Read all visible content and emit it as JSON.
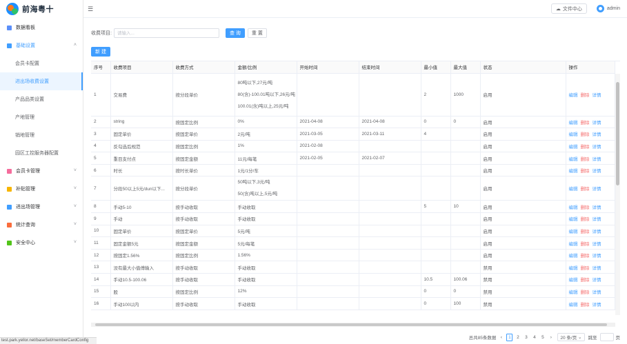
{
  "brand": {
    "name": "前海粤十"
  },
  "sidebar": {
    "items": [
      {
        "label": "数据看板",
        "icon": "dashboard-icon",
        "color": "#5b8ff9"
      },
      {
        "label": "基础设置",
        "icon": "settings-icon",
        "color": "#409eff",
        "expanded": true,
        "children": [
          {
            "label": "会员卡配置"
          },
          {
            "label": "进出场收费设置",
            "selected": true
          },
          {
            "label": "产品品类设置"
          },
          {
            "label": "产地管理"
          },
          {
            "label": "销地管理"
          },
          {
            "label": "园区工控服务器配置"
          }
        ]
      },
      {
        "label": "会员卡管理",
        "icon": "card-icon",
        "color": "#f56c9c"
      },
      {
        "label": "补贴管理",
        "icon": "subsidy-icon",
        "color": "#f7b500"
      },
      {
        "label": "进出场管理",
        "icon": "entry-icon",
        "color": "#409eff"
      },
      {
        "label": "统计查询",
        "icon": "stats-icon",
        "color": "#fa6d3c"
      },
      {
        "label": "安全中心",
        "icon": "shield-icon",
        "color": "#52c41a"
      }
    ]
  },
  "header": {
    "file_center": "文件中心",
    "user": "admin"
  },
  "search": {
    "label": "收费项目:",
    "placeholder": "请输入...",
    "query_btn": "查 询",
    "reset_btn": "重 置",
    "new_btn": "新 建"
  },
  "table": {
    "columns": [
      "序号",
      "收费项目",
      "收费方式",
      "金额/比例",
      "开始时间",
      "结束时间",
      "最小值",
      "最大值",
      "状态",
      "操作"
    ],
    "actions": {
      "edit": "编辑",
      "delete": "删除",
      "detail": "详情"
    },
    "rows": [
      {
        "no": "1",
        "item": "交易费",
        "method": "按分段单价",
        "amount": [
          "80吨以下,27元/吨",
          "80(含)-100.01吨以下,26元/吨",
          "100.01(含)吨以上,25元/吨"
        ],
        "start": "",
        "end": "",
        "min": "2",
        "max": "1000",
        "status": "启用"
      },
      {
        "no": "2",
        "item": "string",
        "method": "按固定比例",
        "amount": [
          "0%"
        ],
        "start": "2021-04-08",
        "end": "2021-04-08",
        "min": "0",
        "max": "0",
        "status": "启用"
      },
      {
        "no": "3",
        "item": "固定单价",
        "method": "按固定单价",
        "amount": [
          "2元/吨"
        ],
        "start": "2021-03-05",
        "end": "2021-03-11",
        "min": "4",
        "max": "",
        "status": "启用"
      },
      {
        "no": "4",
        "item": "反勾选后规范",
        "method": "按固定比例",
        "amount": [
          "1%"
        ],
        "start": "2021-02-08",
        "end": "",
        "min": "",
        "max": "",
        "status": "启用"
      },
      {
        "no": "5",
        "item": "重目支付点",
        "method": "按固定金额",
        "amount": [
          "11元/每笔"
        ],
        "start": "2021-02-05",
        "end": "2021-02-07",
        "min": "",
        "max": "",
        "status": "启用"
      },
      {
        "no": "6",
        "item": "时长",
        "method": "按时长单价",
        "amount": [
          "1元/1分/车"
        ],
        "start": "",
        "end": "",
        "min": "",
        "max": "",
        "status": "启用"
      },
      {
        "no": "7",
        "item": "分段50以上5元/dun以下...",
        "method": "按分段单价",
        "amount": [
          "50吨以下,3元/吨",
          "50(含)吨以上,5元/吨"
        ],
        "start": "",
        "end": "",
        "min": "",
        "max": "",
        "status": "启用"
      },
      {
        "no": "8",
        "item": "手动5-10",
        "method": "按手动收取",
        "amount": [
          "手动收取"
        ],
        "start": "",
        "end": "",
        "min": "5",
        "max": "10",
        "status": "启用"
      },
      {
        "no": "9",
        "item": "手动",
        "method": "按手动收取",
        "amount": [
          "手动收取"
        ],
        "start": "",
        "end": "",
        "min": "",
        "max": "",
        "status": "启用"
      },
      {
        "no": "10",
        "item": "固定单价",
        "method": "按固定单价",
        "amount": [
          "5元/吨"
        ],
        "start": "",
        "end": "",
        "min": "",
        "max": "",
        "status": "启用"
      },
      {
        "no": "11",
        "item": "固定金额5元",
        "method": "按固定金额",
        "amount": [
          "5元/每笔"
        ],
        "start": "",
        "end": "",
        "min": "",
        "max": "",
        "status": "启用"
      },
      {
        "no": "12",
        "item": "按固定1.56%",
        "method": "按固定比例",
        "amount": [
          "1.56%"
        ],
        "start": "",
        "end": "",
        "min": "",
        "max": "",
        "status": "启用"
      },
      {
        "no": "13",
        "item": "没有最大小值傅输入",
        "method": "按手动收取",
        "amount": [
          "手动收取"
        ],
        "start": "",
        "end": "",
        "min": "",
        "max": "",
        "status": "禁用"
      },
      {
        "no": "14",
        "item": "手动10.5-100.06",
        "method": "按手动收取",
        "amount": [
          "手动收取"
        ],
        "start": "",
        "end": "",
        "min": "10.5",
        "max": "100.06",
        "status": "禁用"
      },
      {
        "no": "15",
        "item": "股",
        "method": "按固定比例",
        "amount": [
          "12%"
        ],
        "start": "",
        "end": "",
        "min": "0",
        "max": "0",
        "status": "禁用"
      },
      {
        "no": "16",
        "item": "手动100以内",
        "method": "按手动收取",
        "amount": [
          "手动收取"
        ],
        "start": "",
        "end": "",
        "min": "0",
        "max": "100",
        "status": "禁用"
      }
    ]
  },
  "pagination": {
    "total": "总共85条数据",
    "pages": [
      "1",
      "2",
      "3",
      "4",
      "5"
    ],
    "current": "1",
    "page_size": "20 条/页",
    "goto": "跳至",
    "unit": "页"
  },
  "status_url": "test.park.yellor.net/baseSet/memberCardConfig"
}
